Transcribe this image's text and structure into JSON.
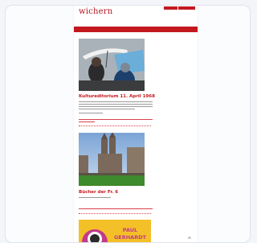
{
  "header": {
    "logo": "wichern"
  },
  "colors": {
    "accent": "#c41820",
    "page_bg": "#ffffff",
    "frame_bg": "#f3f5f8"
  },
  "articles": [
    {
      "headline": "Kultureditorium 11. April 1968"
    },
    {
      "headline": "Bücher der Fr. 6"
    }
  ],
  "poster": {
    "text_line1": "PAUL",
    "text_line2": "GERHARDT"
  },
  "icons": {
    "scroll": "chevron-up-icon"
  }
}
